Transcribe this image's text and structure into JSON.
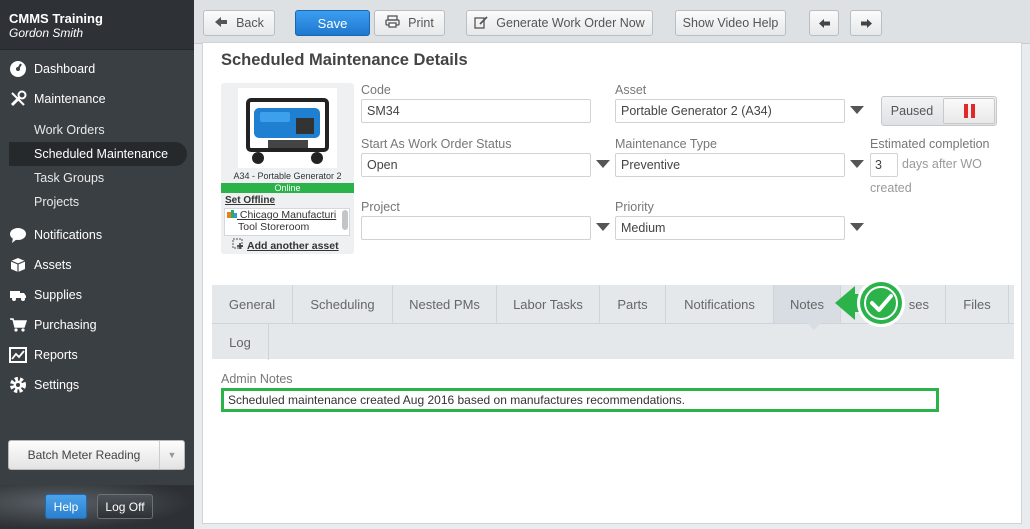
{
  "sidebar": {
    "org": "CMMS Training",
    "user": "Gordon Smith",
    "nav": {
      "dashboard": "Dashboard",
      "maintenance": "Maintenance",
      "notifications": "Notifications",
      "assets": "Assets",
      "supplies": "Supplies",
      "purchasing": "Purchasing",
      "reports": "Reports",
      "settings": "Settings"
    },
    "maintenance_sub": {
      "work_orders": "Work Orders",
      "scheduled_maintenance": "Scheduled Maintenance",
      "task_groups": "Task Groups",
      "projects": "Projects"
    },
    "batch_meter": "Batch Meter Reading",
    "help": "Help",
    "logoff": "Log Off"
  },
  "toolbar": {
    "back": "Back",
    "save": "Save",
    "print": "Print",
    "generate": "Generate Work Order Now",
    "video_help": "Show Video Help"
  },
  "page": {
    "title": "Scheduled Maintenance Details"
  },
  "asset_card": {
    "caption": "A34 - Portable Generator 2",
    "status": "Online",
    "set_offline": "Set Offline",
    "location_1": "Chicago Manufacturi",
    "location_2": "Tool Storeroom",
    "add_asset": "Add another asset"
  },
  "form": {
    "code_label": "Code",
    "code_value": "SM34",
    "asset_label": "Asset",
    "asset_value": "Portable Generator 2 (A34)",
    "paused_label": "Paused",
    "start_status_label": "Start As Work Order Status",
    "start_status_value": "Open",
    "maint_type_label": "Maintenance Type",
    "maint_type_value": "Preventive",
    "est_label": "Estimated completion",
    "est_value": "3",
    "est_suffix_1": "days after WO",
    "est_suffix_2": "created",
    "project_label": "Project",
    "project_value": "",
    "priority_label": "Priority",
    "priority_value": "Medium"
  },
  "tabs": {
    "general": "General",
    "scheduling": "Scheduling",
    "nested_pms": "Nested PMs",
    "labor_tasks": "Labor Tasks",
    "parts": "Parts",
    "notifications": "Notifications",
    "notes": "Notes",
    "uses": "ses",
    "files": "Files",
    "log": "Log"
  },
  "notes": {
    "label": "Admin Notes",
    "value": "Scheduled maintenance created Aug 2016 based on manufactures recommendations."
  },
  "colors": {
    "accent_blue": "#2a7fcf",
    "highlight_green": "#2bb34a",
    "sidebar_bg": "#3a3f43",
    "pause_red": "#e02a2a"
  }
}
